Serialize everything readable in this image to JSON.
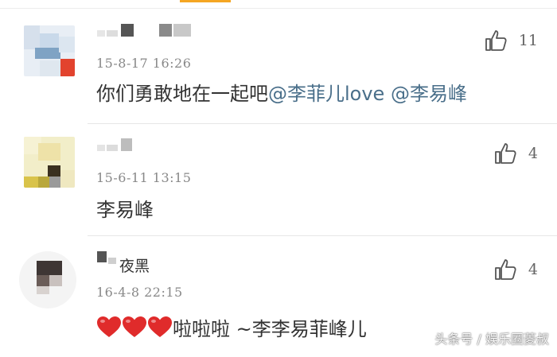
{
  "comments": [
    {
      "username_visible": "",
      "timestamp": "15-8-17 16:26",
      "text_plain": "你们勇敢地在一起吧",
      "mentions": [
        "@李菲儿love",
        "@李易峰"
      ],
      "like_count": "11"
    },
    {
      "username_visible": "",
      "timestamp": "15-6-11 13:15",
      "text_plain": "李易峰",
      "mentions": [],
      "like_count": "4"
    },
    {
      "username_visible": "夜黑",
      "timestamp": "16-4-8 22:15",
      "hearts": 3,
      "text_plain": "啦啦啦 ~李李易菲峰儿",
      "mentions": [],
      "like_count": "4"
    }
  ],
  "watermark": "头条号 / 娱乐圈菱叔",
  "colors": {
    "mention": "#4a6f8a",
    "heart": "#e02b2b",
    "accent_tab": "#f5a623"
  },
  "icons": {
    "like": "thumbs-up-outline-icon",
    "emoji": "red-heart-icon"
  }
}
